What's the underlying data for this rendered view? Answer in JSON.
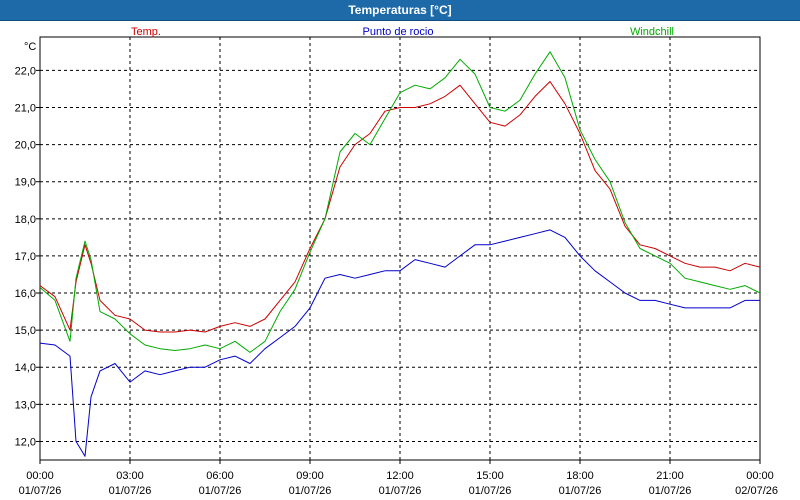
{
  "window": {
    "title": "Temperaturas [°C]"
  },
  "chart_data": {
    "type": "line",
    "title": "Temperaturas [°C]",
    "ylabel": "°C",
    "xlabel": "",
    "grid": true,
    "legend_placement": "top",
    "ylim": [
      11.5,
      22.9
    ],
    "y_ticks": [
      "12,0",
      "13,0",
      "14,0",
      "15,0",
      "16,0",
      "17,0",
      "18,0",
      "19,0",
      "20,0",
      "21,0",
      "22,0"
    ],
    "y_tick_values": [
      12,
      13,
      14,
      15,
      16,
      17,
      18,
      19,
      20,
      21,
      22
    ],
    "x_ticks": [
      {
        "hour": 0,
        "time": "00:00",
        "date": "01/07/26"
      },
      {
        "hour": 3,
        "time": "03:00",
        "date": "01/07/26"
      },
      {
        "hour": 6,
        "time": "06:00",
        "date": "01/07/26"
      },
      {
        "hour": 9,
        "time": "09:00",
        "date": "01/07/26"
      },
      {
        "hour": 12,
        "time": "12:00",
        "date": "01/07/26"
      },
      {
        "hour": 15,
        "time": "15:00",
        "date": "01/07/26"
      },
      {
        "hour": 18,
        "time": "18:00",
        "date": "01/07/26"
      },
      {
        "hour": 21,
        "time": "21:00",
        "date": "01/07/26"
      },
      {
        "hour": 24,
        "time": "00:00",
        "date": "02/07/26"
      }
    ],
    "xlim": [
      0,
      24
    ],
    "x_hours": [
      0,
      0.5,
      1.0,
      1.2,
      1.5,
      1.7,
      2.0,
      2.5,
      3.0,
      3.5,
      4.0,
      4.5,
      5.0,
      5.5,
      6.0,
      6.5,
      7.0,
      7.5,
      8.0,
      8.5,
      9.0,
      9.5,
      10.0,
      10.5,
      11.0,
      11.5,
      12.0,
      12.5,
      13.0,
      13.5,
      14.0,
      14.5,
      15.0,
      15.5,
      16.0,
      16.5,
      17.0,
      17.5,
      18.0,
      18.5,
      19.0,
      19.5,
      20.0,
      20.5,
      21.0,
      21.5,
      22.0,
      22.5,
      23.0,
      23.5,
      24.0
    ],
    "series": [
      {
        "name": "Temp.",
        "color": "#cc0000",
        "values": [
          16.2,
          15.9,
          15.0,
          16.3,
          17.3,
          16.8,
          15.8,
          15.4,
          15.3,
          15.0,
          14.95,
          14.95,
          15.0,
          14.95,
          15.1,
          15.2,
          15.1,
          15.3,
          15.8,
          16.3,
          17.2,
          18.0,
          19.4,
          20.0,
          20.3,
          20.9,
          21.0,
          21.0,
          21.1,
          21.3,
          21.6,
          21.1,
          20.6,
          20.5,
          20.8,
          21.3,
          21.7,
          21.1,
          20.3,
          19.3,
          18.8,
          17.8,
          17.3,
          17.2,
          17.0,
          16.8,
          16.7,
          16.7,
          16.6,
          16.8,
          16.7
        ]
      },
      {
        "name": "Punto de rocio",
        "color": "#0000cc",
        "values": [
          14.65,
          14.6,
          14.3,
          12.0,
          11.6,
          13.2,
          13.9,
          14.1,
          13.6,
          13.9,
          13.8,
          13.9,
          14.0,
          14.0,
          14.2,
          14.3,
          14.1,
          14.5,
          14.8,
          15.1,
          15.6,
          16.4,
          16.5,
          16.4,
          16.5,
          16.6,
          16.6,
          16.9,
          16.8,
          16.7,
          17.0,
          17.3,
          17.3,
          17.4,
          17.5,
          17.6,
          17.7,
          17.5,
          17.0,
          16.6,
          16.3,
          16.0,
          15.8,
          15.8,
          15.7,
          15.6,
          15.6,
          15.6,
          15.6,
          15.8,
          15.8
        ]
      },
      {
        "name": "Windchill",
        "color": "#00aa00",
        "values": [
          16.15,
          15.8,
          14.7,
          16.4,
          17.4,
          16.9,
          15.5,
          15.3,
          14.9,
          14.6,
          14.5,
          14.45,
          14.5,
          14.6,
          14.5,
          14.7,
          14.4,
          14.7,
          15.5,
          16.1,
          17.1,
          18.0,
          19.8,
          20.3,
          20.0,
          20.7,
          21.4,
          21.6,
          21.5,
          21.8,
          22.3,
          21.9,
          21.0,
          20.9,
          21.2,
          21.9,
          22.5,
          21.8,
          20.4,
          19.6,
          19.0,
          17.9,
          17.2,
          17.0,
          16.8,
          16.4,
          16.3,
          16.2,
          16.1,
          16.2,
          16.0
        ]
      }
    ]
  }
}
